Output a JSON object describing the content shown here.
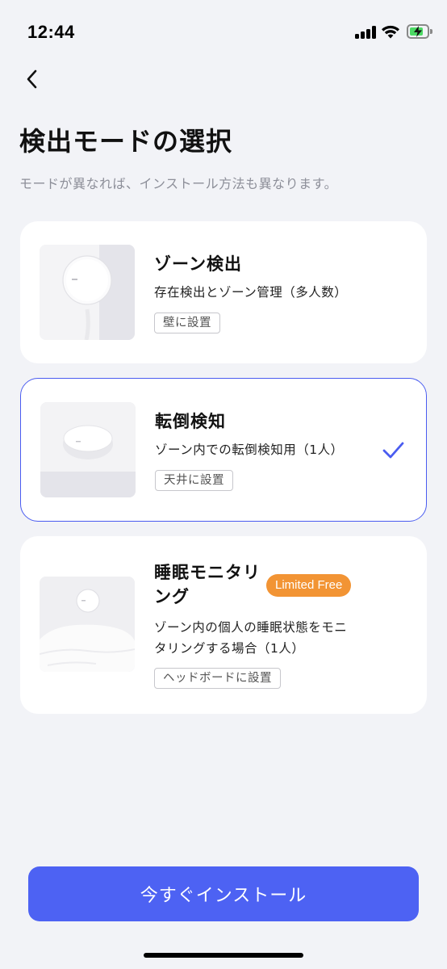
{
  "status_bar": {
    "time": "12:44"
  },
  "header": {
    "title": "検出モードの選択",
    "subtitle": "モードが異なれば、インストール方法も異なります。"
  },
  "modes": [
    {
      "title": "ゾーン検出",
      "description": "存在検出とゾーン管理（多人数）",
      "tag": "壁に設置",
      "selected": false
    },
    {
      "title": "転倒検知",
      "description": "ゾーン内での転倒検知用（1人）",
      "tag": "天井に設置",
      "selected": true
    },
    {
      "title_line1": "睡眠モニタリ",
      "title_line2": "ング",
      "badge": "Limited Free",
      "description_line1": "ゾーン内の個人の睡眠状態をモニ",
      "description_line2": "タリングする場合（1人）",
      "tag": "ヘッドボードに設置",
      "selected": false
    }
  ],
  "install_button": {
    "label": "今すぐインストール"
  },
  "colors": {
    "accent": "#4d62f3",
    "selected_border": "#4a5cf0",
    "badge": "#f29434",
    "background": "#f2f3f7"
  }
}
